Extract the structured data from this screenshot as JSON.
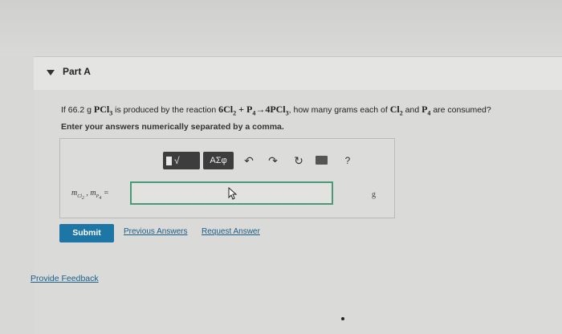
{
  "part": {
    "title": "Part A"
  },
  "question": {
    "prefix": "If 66.2 g ",
    "compound": "PCl",
    "compound_sub": "3",
    "mid": " is produced by the reaction ",
    "reaction": "6Cl",
    "reaction_sub1": "2",
    "reaction_plus": " + P",
    "reaction_sub2": "4",
    "reaction_arrow": "→4PCl",
    "reaction_sub3": "3",
    "suffix1": ", how many grams each of ",
    "species1": "Cl",
    "species1_sub": "2",
    "and": " and ",
    "species2": "P",
    "species2_sub": "4",
    "suffix2": " are consumed?"
  },
  "instruction": "Enter your answers numerically separated by a comma.",
  "toolbar": {
    "templates_label": "√",
    "greek_label": "ΑΣφ",
    "undo_icon": "↶",
    "redo_icon": "↷",
    "reset_icon": "↻",
    "help_icon": "?"
  },
  "answer": {
    "var1": "m",
    "var1_sub": "Cl",
    "var1_subsub": "2",
    "sep": " , ",
    "var2": "m",
    "var2_sub": "P",
    "var2_subsub": "4",
    "equals": " =",
    "value": "",
    "unit": "g"
  },
  "actions": {
    "submit_label": "Submit",
    "previous_label": "Previous Answers",
    "request_label": "Request Answer"
  },
  "footer": {
    "feedback_label": "Provide Feedback"
  }
}
